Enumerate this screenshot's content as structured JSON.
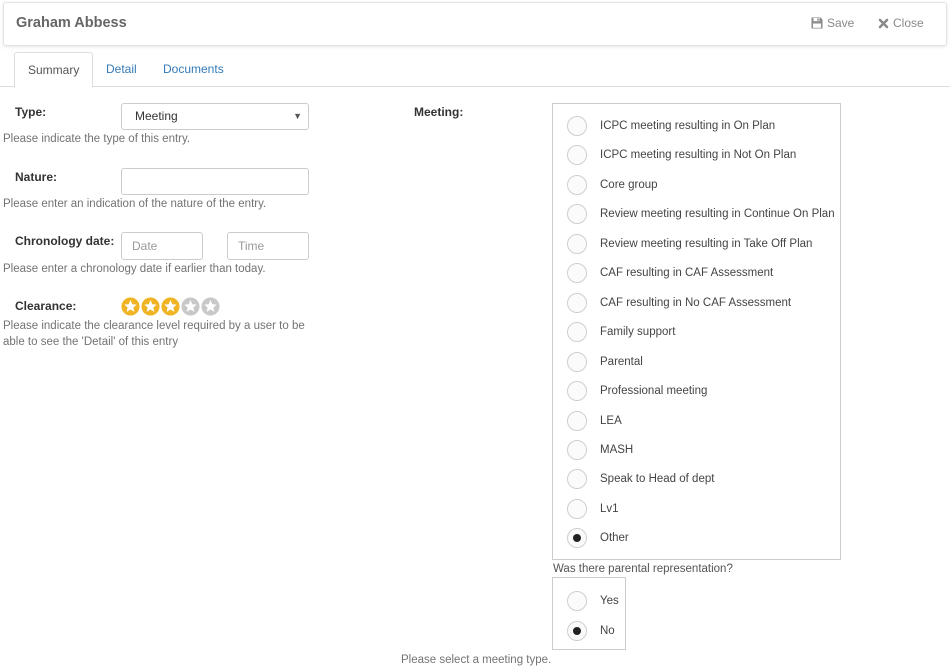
{
  "header": {
    "title": "Graham Abbess",
    "save_label": "Save",
    "close_label": "Close"
  },
  "tabs": [
    {
      "label": "Summary",
      "active": true
    },
    {
      "label": "Detail",
      "active": false
    },
    {
      "label": "Documents",
      "active": false
    }
  ],
  "form": {
    "type": {
      "label": "Type:",
      "value": "Meeting",
      "help": "Please indicate the type of this entry."
    },
    "nature": {
      "label": "Nature:",
      "value": "",
      "help": "Please enter an indication of the nature of the entry."
    },
    "chronology": {
      "label": "Chronology date:",
      "date_placeholder": "Date",
      "time_placeholder": "Time",
      "help": "Please enter a chronology date if earlier than today."
    },
    "clearance": {
      "label": "Clearance:",
      "rating": 3,
      "max": 5,
      "help_line1": "Please indicate the clearance level required by a user to be",
      "help_line2": "able to see the 'Detail' of this entry"
    },
    "meeting": {
      "label": "Meeting:",
      "selected": "Other",
      "options": [
        "ICPC meeting resulting in On Plan",
        "ICPC meeting resulting in Not On Plan",
        "Core group",
        "Review meeting resulting in Continue On Plan",
        "Review meeting resulting in Take Off Plan",
        "CAF resulting in CAF Assessment",
        "CAF resulting in No CAF Assessment",
        "Family support",
        "Parental",
        "Professional meeting",
        "LEA",
        "MASH",
        "Speak to Head of dept",
        "Lv1",
        "Other"
      ]
    },
    "parental": {
      "question": "Was there parental representation?",
      "selected": "No",
      "options": [
        "Yes",
        "No"
      ]
    },
    "meeting_help": "Please select a meeting type."
  },
  "colors": {
    "star_filled": "#f0b323",
    "star_empty": "#c8c8c8",
    "link": "#337ab7"
  },
  "icons": {
    "save": "floppy-disk-icon",
    "close": "x-icon",
    "star": "star-icon"
  }
}
